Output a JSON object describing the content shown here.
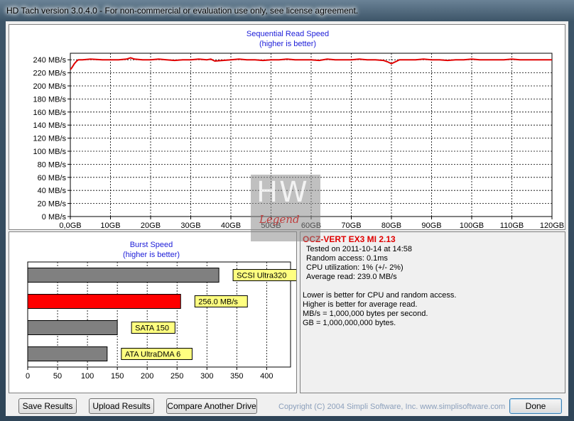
{
  "window": {
    "title": "HD Tach version 3.0.4.0  - For non-commercial or evaluation use only, see license agreement."
  },
  "colors": {
    "read_line": "#e00000",
    "current_bar": "#ff0000",
    "ref_bar": "#808080",
    "label_bg": "#ffff80",
    "title_blue": "#1c1cd8"
  },
  "chart_data": [
    {
      "type": "line",
      "title": "Sequential Read Speed",
      "subtitle": "(higher is better)",
      "xlabel": "",
      "ylabel": "",
      "x_ticks": [
        "0,0GB",
        "10GB",
        "20GB",
        "30GB",
        "40GB",
        "50GB",
        "60GB",
        "70GB",
        "80GB",
        "90GB",
        "100GB",
        "110GB",
        "120GB"
      ],
      "y_ticks": [
        "0 MB/s",
        "20 MB/s",
        "40 MB/s",
        "60 MB/s",
        "80 MB/s",
        "100 MB/s",
        "120 MB/s",
        "140 MB/s",
        "160 MB/s",
        "180 MB/s",
        "200 MB/s",
        "220 MB/s",
        "240 MB/s"
      ],
      "xlim": [
        0,
        120
      ],
      "ylim": [
        0,
        250
      ],
      "grid": true,
      "series": [
        {
          "x": [
            0,
            0.4,
            1,
            1.6,
            2,
            3,
            5,
            8,
            10,
            12,
            14,
            15,
            16,
            18,
            20,
            22,
            24,
            26,
            28,
            30,
            32,
            34,
            35,
            36,
            38,
            40,
            42,
            44,
            46,
            48,
            50,
            52,
            54,
            56,
            58,
            60,
            62,
            64,
            66,
            68,
            70,
            72,
            74,
            76,
            78,
            79,
            80,
            81,
            82,
            84,
            86,
            88,
            90,
            92,
            94,
            96,
            98,
            100,
            102,
            104,
            106,
            108,
            110,
            112,
            114,
            116,
            118,
            120
          ],
          "y": [
            225,
            228,
            234,
            238,
            240,
            240,
            241,
            240,
            240,
            240,
            241,
            243,
            241,
            240,
            240,
            241,
            240,
            239,
            240,
            240,
            241,
            240,
            241,
            238,
            239,
            240,
            241,
            240,
            240,
            239,
            240,
            240,
            241,
            240,
            240,
            240,
            239,
            241,
            240,
            240,
            240,
            241,
            240,
            240,
            239,
            237,
            234,
            237,
            240,
            240,
            240,
            241,
            240,
            240,
            239,
            240,
            240,
            241,
            240,
            240,
            240,
            240,
            241,
            240,
            240,
            240,
            240,
            240
          ]
        }
      ]
    },
    {
      "type": "bar",
      "orientation": "horizontal",
      "title": "Burst Speed",
      "subtitle": "(higher is better)",
      "x_ticks": [
        "0",
        "50",
        "100",
        "150",
        "200",
        "250",
        "300",
        "350",
        "400"
      ],
      "xlim": [
        0,
        440
      ],
      "grid": true,
      "bars": [
        {
          "label": "SCSI Ultra320",
          "value": 320,
          "current": false
        },
        {
          "label": "256.0 MB/s",
          "value": 256,
          "current": true
        },
        {
          "label": "SATA 150",
          "value": 150,
          "current": false
        },
        {
          "label": "ATA UltraDMA 6",
          "value": 133,
          "current": false
        }
      ]
    }
  ],
  "results": {
    "drive": "OCZ-VERT EX3 MI 2.13",
    "tested_on": "Tested on 2011-10-14 at 14:58",
    "random_access": "Random access: 0.1ms",
    "cpu": "CPU utilization: 1% (+/- 2%)",
    "average_read": "Average read: 239.0 MB/s",
    "notes": [
      "Lower is better for CPU and random access.",
      "Higher is better for average read.",
      "MB/s = 1,000,000 bytes per second.",
      "GB = 1,000,000,000 bytes."
    ]
  },
  "watermark": {
    "text": "HW",
    "sub": "Legend"
  },
  "buttons": {
    "save": "Save Results",
    "upload": "Upload Results",
    "compare": "Compare Another Drive",
    "done": "Done"
  },
  "footer": {
    "copyright": "Copyright (C) 2004 Simpli Software, Inc. www.simplisoftware.com"
  }
}
